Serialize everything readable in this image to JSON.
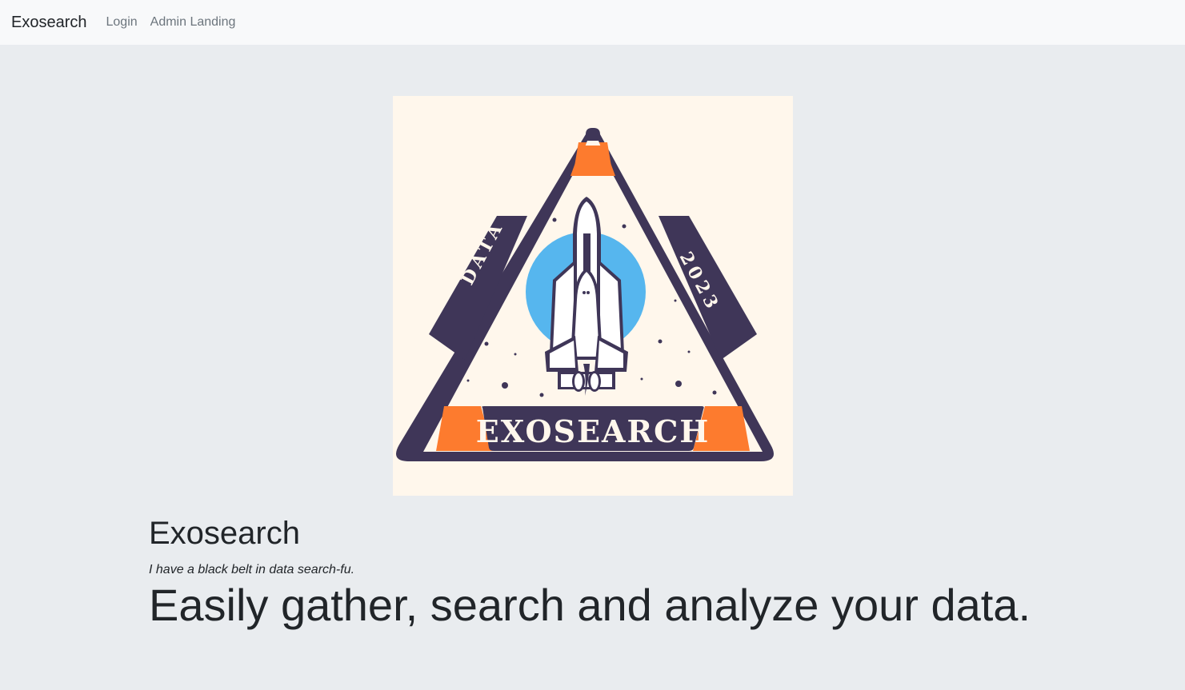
{
  "navbar": {
    "brand": "Exosearch",
    "links": [
      {
        "label": "Login"
      },
      {
        "label": "Admin Landing"
      }
    ]
  },
  "hero": {
    "logo": {
      "left_text": "DATA",
      "right_text": "2023",
      "banner_text": "EXOSEARCH",
      "colors": {
        "background": "#fff7ec",
        "frame": "#3f3658",
        "accent": "#fd7b2e",
        "planet": "#56b6ee"
      }
    },
    "title": "Exosearch",
    "tagline": "I have a black belt in data search-fu.",
    "headline": "Easily gather, search and analyze your data."
  }
}
